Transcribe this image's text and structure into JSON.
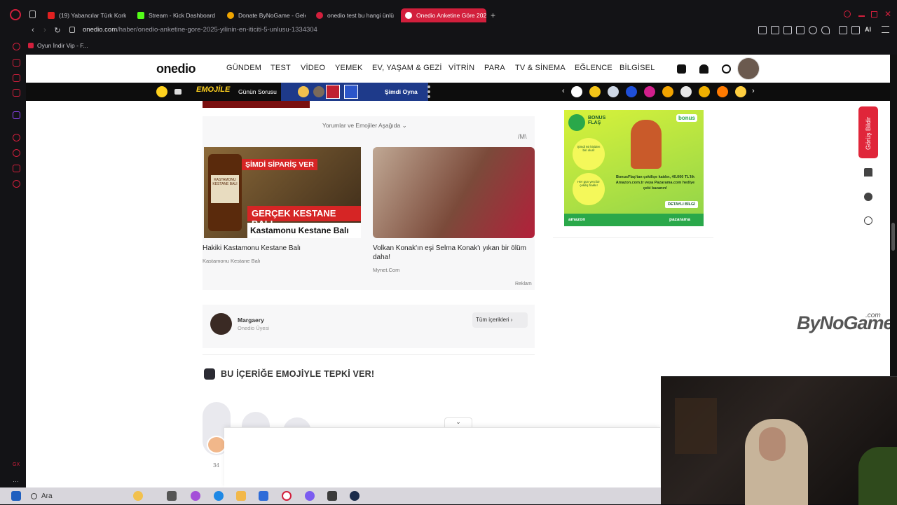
{
  "browser": {
    "tabs": [
      {
        "label": "(19) Yabancılar Türk Korku",
        "color": "#e02020"
      },
      {
        "label": "Stream - Kick Dashboard",
        "color": "#53fc18"
      },
      {
        "label": "Donate ByNoGame - Gele",
        "color": "#f0a500"
      },
      {
        "label": "onedio test bu hangi ünlü",
        "color": "#d21f3c"
      },
      {
        "label": "Onedio Anketine Göre 202",
        "color": "#ffffff"
      }
    ],
    "new_tab": "+",
    "url_host": "onedio.com",
    "url_path": "/haber/onedio-anketine-gore-2025-yilinin-en-iticiti-5-unlusu-1334304",
    "bookmark": "Oyun İndir Vip - F...",
    "ai_label": "AI"
  },
  "site": {
    "logo": "onedio",
    "nav": [
      "GÜNDEM",
      "TEST",
      "VİDEO",
      "YEMEK",
      "EV, YAŞAM & GEZİ",
      "VİTRİN",
      "PARA",
      "TV & SİNEMA",
      "EĞLENCE",
      "BİLGİSEL"
    ],
    "strip": {
      "emojile": "EMOJİLE",
      "gunun": "Günün Sorusu",
      "simdi": "Şimdi Oyna"
    }
  },
  "article": {
    "comments_toggle": "Yorumlar ve Emojiler Aşağıda",
    "ad_badge": "/M\\",
    "cards": [
      {
        "image_text_1": "ŞİMDİ SİPARİŞ VER",
        "image_text_2": "GERÇEK KESTANE BALI",
        "image_text_3": "Kastamonu Kestane Balı",
        "jar_label": "KASTAMONU KESTANE BALI",
        "title": "Hakiki Kastamonu Kestane Balı",
        "source": "Kastamonu Kestane Balı"
      },
      {
        "title": "Volkan Konak'ın eşi Selma Konak'ı yıkan bir ölüm daha!",
        "source": "Mynet.Com"
      }
    ],
    "reklam": "Reklam",
    "author": {
      "name": "Margaery",
      "role": "Onedio Üyesi",
      "button": "Tüm içerikleri"
    },
    "emoji_heading": "BU İÇERİĞE EMOJİYLE TEPKİ VER!",
    "emoji_count": "34"
  },
  "right_ad": {
    "brand": "BONUS FLAŞ",
    "circle1": "Şimdi 60 kişiden biri olun!",
    "circle2": "Her gün yeni bir çekiliş hakkı!",
    "main": "BonusFlaş'tan çekilişe katılın, 40.000 TL'lik Amazon.com.tr veya Pazarama.com hediye çeki kazanın!",
    "cta": "DETAYLI BİLGİ",
    "left_logo": "amazon",
    "right_logo": "pazarama",
    "bonus_badge": "bonus"
  },
  "floating": {
    "feedback": "Görüş Bildir"
  },
  "watermark": {
    "brand": "ByNoGame",
    "suffix": ".com"
  },
  "taskbar": {
    "search": "Ara"
  }
}
